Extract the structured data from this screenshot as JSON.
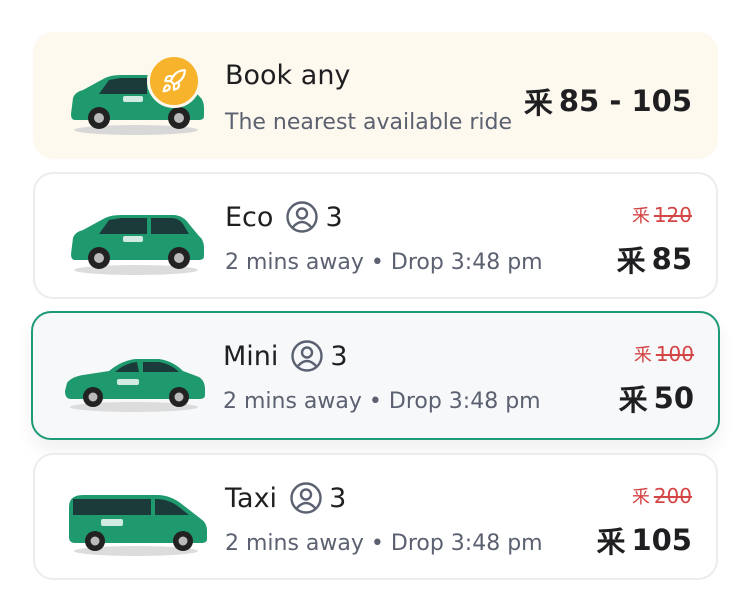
{
  "colors": {
    "accent_green": "#1f9a78",
    "book_bg": "#fdf9ee",
    "badge_orange": "#f6b32b",
    "strike_red": "#d44545"
  },
  "currency_symbol": "⾤",
  "book_any": {
    "title": "Book any",
    "subtitle": "The nearest available ride",
    "price_range": "85 - 105",
    "badge_icon": "rocket-icon"
  },
  "rides": [
    {
      "key": "eco",
      "name": "Eco",
      "seats": "3",
      "eta": "2 mins away",
      "drop": "Drop 3:48 pm",
      "old_price": "120",
      "price": "85",
      "vehicle_icon": "suv-icon"
    },
    {
      "key": "mini",
      "name": "Mini",
      "seats": "3",
      "eta": "2 mins away",
      "drop": "Drop 3:48 pm",
      "old_price": "100",
      "price": "50",
      "vehicle_icon": "sedan-icon",
      "selected": true
    },
    {
      "key": "taxi",
      "name": "Taxi",
      "seats": "3",
      "eta": "2 mins away",
      "drop": "Drop 3:48 pm",
      "old_price": "200",
      "price": "105",
      "vehicle_icon": "van-icon"
    }
  ]
}
